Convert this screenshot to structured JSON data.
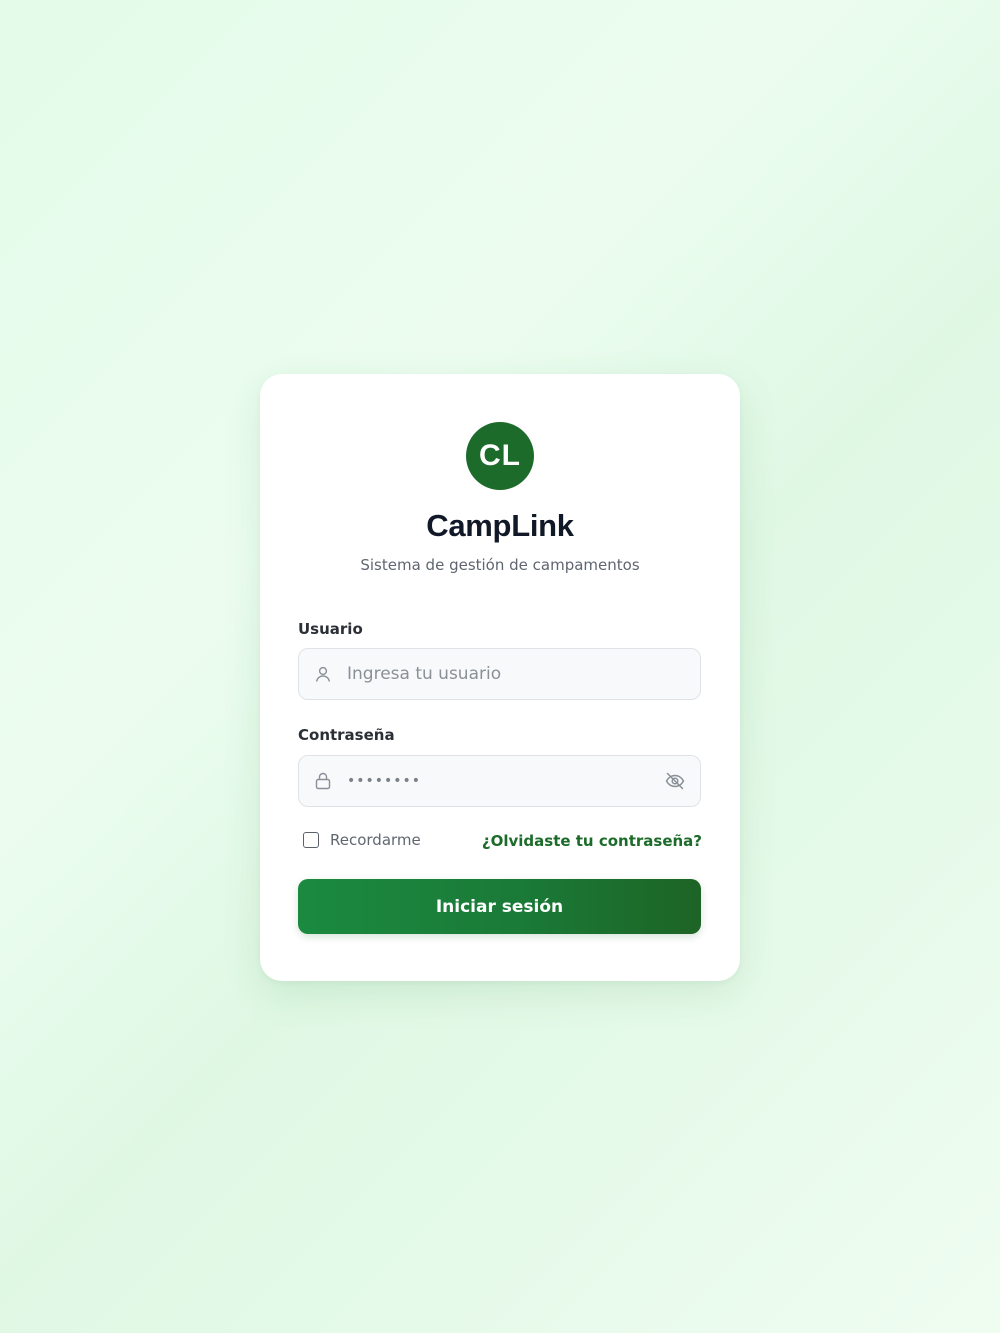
{
  "brand": {
    "logo_initials": "CL",
    "name": "CampLink",
    "tagline": "Sistema de gestión de campamentos"
  },
  "form": {
    "username": {
      "label": "Usuario",
      "placeholder": "Ingresa tu usuario",
      "value": "",
      "icon": "user-icon"
    },
    "password": {
      "label": "Contraseña",
      "value": "••••••••",
      "icon": "lock-icon",
      "toggle_icon": "eye-off-icon"
    },
    "remember_me": {
      "label": "Recordarme",
      "checked": false
    },
    "forgot_link": "¿Olvidaste tu contraseña?",
    "submit_label": "Iniciar sesión"
  },
  "colors": {
    "accent": "#1d6b2a",
    "button_gradient_start": "#1b8a40",
    "button_gradient_end": "#1d6426",
    "background": "#e4fbe9"
  }
}
